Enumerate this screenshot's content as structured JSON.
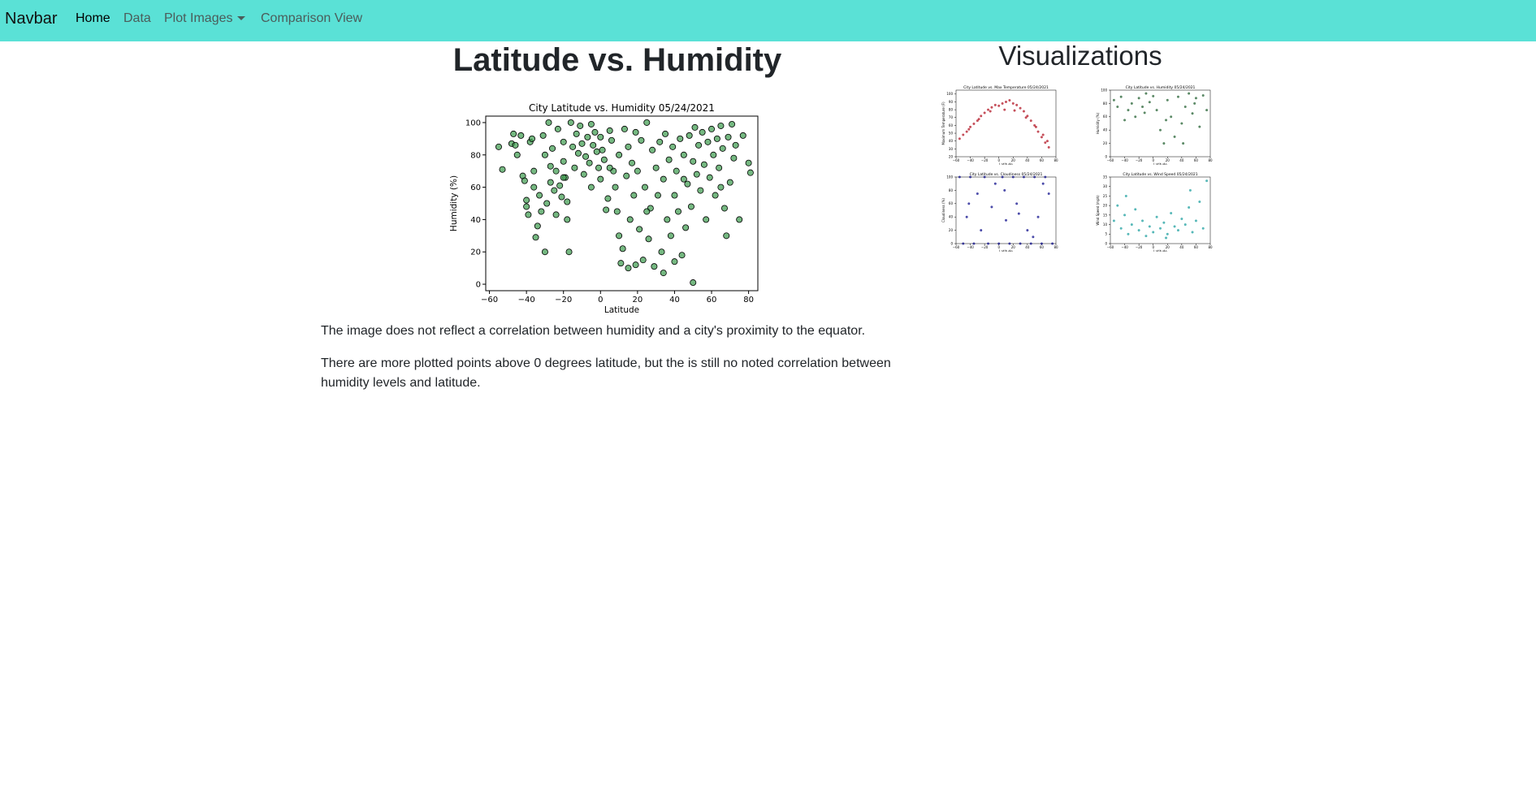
{
  "navbar": {
    "brand": "Navbar",
    "items": [
      {
        "label": "Home",
        "active": true
      },
      {
        "label": "Data",
        "active": false
      },
      {
        "label": "Plot Images",
        "active": false,
        "dropdown": true
      },
      {
        "label": "Comparison View",
        "active": false
      }
    ],
    "background": "#5ae1d6"
  },
  "main": {
    "title": "Latitude vs. Humidity",
    "paragraphs": [
      "The image does not reflect a correlation between humidity and a city's proximity to the equator.",
      "There are more plotted points above 0 degrees latitude, but the is still no noted correlation between humidity levels and latitude."
    ]
  },
  "sidebar": {
    "title": "Visualizations"
  },
  "chart_data": [
    {
      "type": "scatter",
      "title": "City Latitude vs. Humidity 05/24/2021",
      "xlabel": "Latitude",
      "ylabel": "Humidity (%)",
      "xlim": [
        -62,
        85
      ],
      "ylim": [
        -4,
        104
      ],
      "xticks": [
        -60,
        -40,
        -20,
        0,
        20,
        40,
        60,
        80
      ],
      "yticks": [
        0,
        20,
        40,
        60,
        80,
        100
      ],
      "grid": false,
      "color": "#3a9a4c",
      "edge_color": "#000000",
      "points": [
        [
          -55,
          85
        ],
        [
          -53,
          71
        ],
        [
          -48,
          87
        ],
        [
          -47,
          93
        ],
        [
          -46,
          86
        ],
        [
          -45,
          80
        ],
        [
          -43,
          92
        ],
        [
          -42,
          67
        ],
        [
          -41,
          64
        ],
        [
          -40,
          52
        ],
        [
          -40,
          48
        ],
        [
          -39,
          43
        ],
        [
          -38,
          88
        ],
        [
          -37,
          90
        ],
        [
          -36,
          70
        ],
        [
          -36,
          60
        ],
        [
          -35,
          29
        ],
        [
          -34,
          36
        ],
        [
          -33,
          55
        ],
        [
          -32,
          45
        ],
        [
          -31,
          92
        ],
        [
          -30,
          80
        ],
        [
          -30,
          20
        ],
        [
          -29,
          50
        ],
        [
          -28,
          100
        ],
        [
          -27,
          73
        ],
        [
          -27,
          63
        ],
        [
          -26,
          84
        ],
        [
          -25,
          58
        ],
        [
          -24,
          70
        ],
        [
          -24,
          43
        ],
        [
          -23,
          96
        ],
        [
          -22,
          61
        ],
        [
          -21,
          54
        ],
        [
          -20,
          88
        ],
        [
          -20,
          76
        ],
        [
          -19,
          66
        ],
        [
          -18,
          51
        ],
        [
          -18,
          40
        ],
        [
          -17,
          20
        ],
        [
          -16,
          100
        ],
        [
          -15,
          85
        ],
        [
          -14,
          72
        ],
        [
          -13,
          93
        ],
        [
          -12,
          81
        ],
        [
          -11,
          98
        ],
        [
          -10,
          87
        ],
        [
          -9,
          68
        ],
        [
          -8,
          79
        ],
        [
          -7,
          91
        ],
        [
          -6,
          75
        ],
        [
          -5,
          60
        ],
        [
          -5,
          99
        ],
        [
          -4,
          86
        ],
        [
          -3,
          94
        ],
        [
          -2,
          82
        ],
        [
          -1,
          72
        ],
        [
          0,
          91
        ],
        [
          0,
          65
        ],
        [
          1,
          83
        ],
        [
          2,
          77
        ],
        [
          3,
          46
        ],
        [
          4,
          53
        ],
        [
          5,
          95
        ],
        [
          6,
          89
        ],
        [
          7,
          70
        ],
        [
          8,
          60
        ],
        [
          9,
          45
        ],
        [
          10,
          30
        ],
        [
          10,
          80
        ],
        [
          11,
          13
        ],
        [
          12,
          22
        ],
        [
          13,
          96
        ],
        [
          14,
          67
        ],
        [
          15,
          10
        ],
        [
          15,
          85
        ],
        [
          16,
          40
        ],
        [
          17,
          75
        ],
        [
          18,
          55
        ],
        [
          19,
          94
        ],
        [
          19,
          12
        ],
        [
          20,
          70
        ],
        [
          21,
          34
        ],
        [
          22,
          89
        ],
        [
          23,
          15
        ],
        [
          24,
          60
        ],
        [
          25,
          100
        ],
        [
          26,
          28
        ],
        [
          27,
          47
        ],
        [
          28,
          83
        ],
        [
          29,
          11
        ],
        [
          30,
          72
        ],
        [
          31,
          55
        ],
        [
          32,
          88
        ],
        [
          33,
          20
        ],
        [
          34,
          65
        ],
        [
          34,
          7
        ],
        [
          35,
          93
        ],
        [
          36,
          40
        ],
        [
          37,
          77
        ],
        [
          38,
          30
        ],
        [
          39,
          85
        ],
        [
          40,
          14
        ],
        [
          40,
          55
        ],
        [
          41,
          70
        ],
        [
          42,
          45
        ],
        [
          43,
          90
        ],
        [
          44,
          18
        ],
        [
          45,
          80
        ],
        [
          46,
          35
        ],
        [
          47,
          62
        ],
        [
          48,
          92
        ],
        [
          49,
          48
        ],
        [
          50,
          76
        ],
        [
          50,
          1
        ],
        [
          51,
          97
        ],
        [
          52,
          68
        ],
        [
          53,
          86
        ],
        [
          54,
          58
        ],
        [
          55,
          94
        ],
        [
          56,
          74
        ],
        [
          57,
          40
        ],
        [
          58,
          88
        ],
        [
          59,
          66
        ],
        [
          60,
          96
        ],
        [
          61,
          80
        ],
        [
          62,
          55
        ],
        [
          63,
          90
        ],
        [
          64,
          72
        ],
        [
          65,
          98
        ],
        [
          66,
          84
        ],
        [
          67,
          47
        ],
        [
          68,
          30
        ],
        [
          69,
          91
        ],
        [
          70,
          63
        ],
        [
          71,
          99
        ],
        [
          72,
          78
        ],
        [
          73,
          86
        ],
        [
          75,
          40
        ],
        [
          77,
          92
        ],
        [
          80,
          75
        ],
        [
          81,
          69
        ],
        [
          -20,
          66
        ],
        [
          5,
          72
        ],
        [
          25,
          45
        ],
        [
          45,
          65
        ],
        [
          65,
          60
        ]
      ]
    },
    {
      "type": "scatter",
      "title": "City Latitude vs. Max Temperature 05/24/2021",
      "xlabel": "Latitude",
      "ylabel": "Maximum Temperature (F)",
      "xlim": [
        -60,
        80
      ],
      "ylim": [
        20,
        105
      ],
      "xticks": [
        -60,
        -40,
        -20,
        0,
        20,
        40,
        60,
        80
      ],
      "yticks": [
        20,
        30,
        40,
        50,
        60,
        70,
        80,
        90,
        100
      ],
      "color": "#b01020",
      "points": [
        [
          -55,
          43
        ],
        [
          -50,
          48
        ],
        [
          -45,
          52
        ],
        [
          -40,
          58
        ],
        [
          -35,
          62
        ],
        [
          -30,
          66
        ],
        [
          -25,
          72
        ],
        [
          -20,
          76
        ],
        [
          -15,
          80
        ],
        [
          -10,
          83
        ],
        [
          -5,
          86
        ],
        [
          0,
          85
        ],
        [
          5,
          88
        ],
        [
          10,
          90
        ],
        [
          15,
          92
        ],
        [
          20,
          88
        ],
        [
          25,
          86
        ],
        [
          30,
          82
        ],
        [
          35,
          78
        ],
        [
          40,
          72
        ],
        [
          45,
          66
        ],
        [
          50,
          60
        ],
        [
          55,
          52
        ],
        [
          60,
          45
        ],
        [
          65,
          38
        ],
        [
          70,
          32
        ],
        [
          -42,
          55
        ],
        [
          -28,
          68
        ],
        [
          -12,
          78
        ],
        [
          8,
          80
        ],
        [
          22,
          79
        ],
        [
          38,
          70
        ],
        [
          52,
          58
        ],
        [
          62,
          48
        ],
        [
          68,
          40
        ]
      ]
    },
    {
      "type": "scatter",
      "title": "City Latitude vs. Humidity 05/24/2021",
      "xlabel": "Latitude",
      "ylabel": "Humidity (%)",
      "xlim": [
        -60,
        80
      ],
      "ylim": [
        0,
        100
      ],
      "xticks": [
        -60,
        -40,
        -20,
        0,
        20,
        40,
        60,
        80
      ],
      "yticks": [
        0,
        20,
        40,
        60,
        80,
        100
      ],
      "color": "#1f5e2e",
      "points": [
        [
          -55,
          85
        ],
        [
          -45,
          90
        ],
        [
          -40,
          55
        ],
        [
          -35,
          70
        ],
        [
          -30,
          80
        ],
        [
          -25,
          60
        ],
        [
          -20,
          88
        ],
        [
          -15,
          75
        ],
        [
          -10,
          95
        ],
        [
          -5,
          82
        ],
        [
          0,
          91
        ],
        [
          5,
          70
        ],
        [
          10,
          40
        ],
        [
          15,
          20
        ],
        [
          20,
          85
        ],
        [
          25,
          60
        ],
        [
          30,
          30
        ],
        [
          35,
          90
        ],
        [
          40,
          50
        ],
        [
          45,
          75
        ],
        [
          50,
          95
        ],
        [
          55,
          65
        ],
        [
          60,
          88
        ],
        [
          65,
          45
        ],
        [
          70,
          92
        ],
        [
          75,
          70
        ],
        [
          -50,
          75
        ],
        [
          -12,
          66
        ],
        [
          18,
          55
        ],
        [
          42,
          20
        ],
        [
          58,
          80
        ]
      ]
    },
    {
      "type": "scatter",
      "title": "City Latitude vs. Cloudiness 05/24/2021",
      "xlabel": "Latitude",
      "ylabel": "Cloudiness (%)",
      "xlim": [
        -60,
        80
      ],
      "ylim": [
        0,
        100
      ],
      "xticks": [
        -60,
        -40,
        -20,
        0,
        20,
        40,
        60,
        80
      ],
      "yticks": [
        0,
        20,
        40,
        60,
        80,
        100
      ],
      "color": "#0a0a8a",
      "points": [
        [
          -55,
          100
        ],
        [
          -50,
          0
        ],
        [
          -45,
          40
        ],
        [
          -40,
          100
        ],
        [
          -35,
          0
        ],
        [
          -30,
          75
        ],
        [
          -25,
          20
        ],
        [
          -20,
          100
        ],
        [
          -15,
          0
        ],
        [
          -10,
          55
        ],
        [
          -5,
          90
        ],
        [
          0,
          0
        ],
        [
          5,
          100
        ],
        [
          10,
          35
        ],
        [
          15,
          0
        ],
        [
          20,
          100
        ],
        [
          25,
          60
        ],
        [
          30,
          0
        ],
        [
          35,
          100
        ],
        [
          40,
          20
        ],
        [
          45,
          0
        ],
        [
          50,
          100
        ],
        [
          55,
          40
        ],
        [
          60,
          0
        ],
        [
          65,
          100
        ],
        [
          70,
          75
        ],
        [
          75,
          0
        ],
        [
          -42,
          60
        ],
        [
          8,
          80
        ],
        [
          28,
          45
        ],
        [
          48,
          10
        ],
        [
          62,
          90
        ]
      ]
    },
    {
      "type": "scatter",
      "title": "City Latitude vs. Wind Speed 05/24/2021",
      "xlabel": "Latitude",
      "ylabel": "Wind Speed (mph)",
      "xlim": [
        -60,
        80
      ],
      "ylim": [
        0,
        35
      ],
      "xticks": [
        -60,
        -40,
        -20,
        0,
        20,
        40,
        60,
        80
      ],
      "yticks": [
        0,
        5,
        10,
        15,
        20,
        25,
        30,
        35
      ],
      "color": "#1a9e9e",
      "points": [
        [
          -55,
          12
        ],
        [
          -50,
          20
        ],
        [
          -45,
          8
        ],
        [
          -40,
          15
        ],
        [
          -35,
          5
        ],
        [
          -30,
          10
        ],
        [
          -25,
          18
        ],
        [
          -20,
          7
        ],
        [
          -15,
          12
        ],
        [
          -10,
          4
        ],
        [
          -5,
          9
        ],
        [
          0,
          6
        ],
        [
          5,
          14
        ],
        [
          10,
          8
        ],
        [
          15,
          11
        ],
        [
          20,
          5
        ],
        [
          25,
          16
        ],
        [
          30,
          9
        ],
        [
          35,
          7
        ],
        [
          40,
          13
        ],
        [
          45,
          10
        ],
        [
          50,
          19
        ],
        [
          55,
          6
        ],
        [
          60,
          12
        ],
        [
          65,
          22
        ],
        [
          70,
          8
        ],
        [
          75,
          33
        ],
        [
          -38,
          25
        ],
        [
          18,
          3
        ],
        [
          52,
          28
        ]
      ]
    }
  ]
}
